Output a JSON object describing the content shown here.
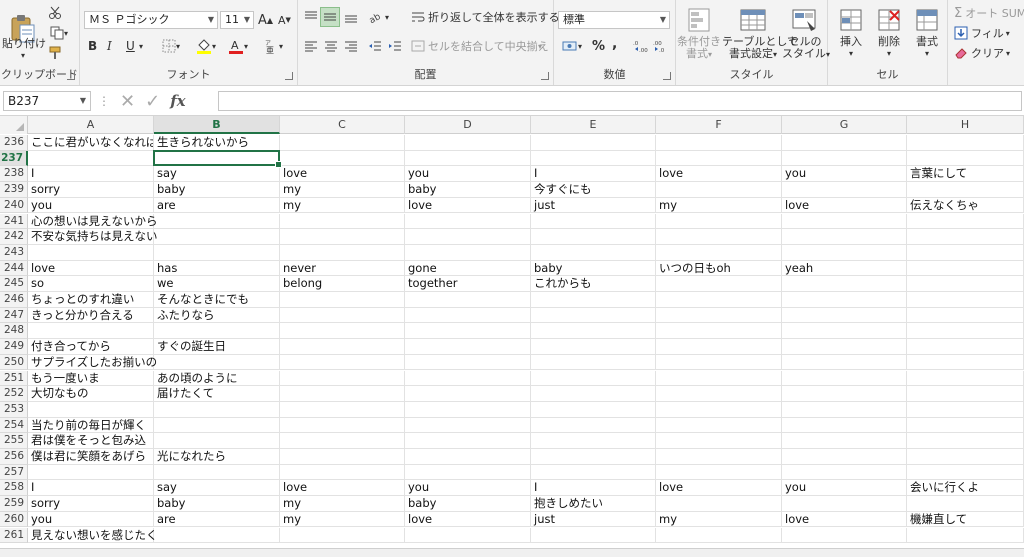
{
  "ribbon": {
    "clipboard": {
      "label": "クリップボード",
      "paste_label": "貼り付け"
    },
    "font": {
      "label": "フォント",
      "font_name": "ＭＳ Ｐゴシック",
      "font_size": "11",
      "bold": "B",
      "italic": "I",
      "underline": "U"
    },
    "alignment": {
      "label": "配置",
      "wrap_text": "折り返して全体を表示する",
      "merge_center": "セルを結合して中央揃え"
    },
    "number": {
      "label": "数値",
      "format": "標準",
      "percent": "%",
      "comma": ","
    },
    "styles": {
      "label": "スタイル",
      "conditional_line1": "条件付き",
      "conditional_line2": "書式",
      "table_line1": "テーブルとして",
      "table_line2": "書式設定",
      "cell_line1": "セルの",
      "cell_line2": "スタイル"
    },
    "cells": {
      "label": "セル",
      "insert": "挿入",
      "delete": "削除",
      "format": "書式"
    },
    "editing": {
      "autosum": "オート SUM",
      "fill": "フィル",
      "clear": "クリア"
    }
  },
  "formula_bar": {
    "name_box": "B237",
    "formula": ""
  },
  "grid": {
    "columns": [
      "A",
      "B",
      "C",
      "D",
      "E",
      "F",
      "G",
      "H"
    ],
    "active_column": "B",
    "active_row": "237",
    "rows": [
      {
        "n": "236",
        "cells": [
          "ここに君がいなくなれば",
          "生きられないから",
          "",
          "",
          "",
          "",
          "",
          ""
        ]
      },
      {
        "n": "237",
        "cells": [
          "",
          "",
          "",
          "",
          "",
          "",
          "",
          ""
        ]
      },
      {
        "n": "238",
        "cells": [
          "I",
          "say",
          "love",
          "you",
          "I",
          "love",
          "you",
          "言葉にして"
        ]
      },
      {
        "n": "239",
        "cells": [
          "sorry",
          "baby",
          "my",
          "baby",
          "今すぐにも",
          "",
          "",
          ""
        ]
      },
      {
        "n": "240",
        "cells": [
          "you",
          "are",
          "my",
          "love",
          "just",
          "my",
          "love",
          "伝えなくちゃ"
        ]
      },
      {
        "n": "241",
        "cells": [
          "心の想いは見えないから",
          "",
          "",
          "",
          "",
          "",
          "",
          ""
        ]
      },
      {
        "n": "242",
        "cells": [
          "不安な気持ちは見えない",
          "",
          "",
          "",
          "",
          "",
          "",
          ""
        ]
      },
      {
        "n": "243",
        "cells": [
          "",
          "",
          "",
          "",
          "",
          "",
          "",
          ""
        ]
      },
      {
        "n": "244",
        "cells": [
          "love",
          "has",
          "never",
          "gone",
          "baby",
          "いつの日もoh",
          "yeah",
          ""
        ]
      },
      {
        "n": "245",
        "cells": [
          "so",
          "we",
          "belong",
          "together",
          "これからも",
          "",
          "",
          ""
        ]
      },
      {
        "n": "246",
        "cells": [
          "ちょっとのすれ違い",
          "そんなときにでも",
          "",
          "",
          "",
          "",
          "",
          ""
        ]
      },
      {
        "n": "247",
        "cells": [
          "きっと分かり合える",
          "ふたりなら",
          "",
          "",
          "",
          "",
          "",
          ""
        ]
      },
      {
        "n": "248",
        "cells": [
          "",
          "",
          "",
          "",
          "",
          "",
          "",
          ""
        ]
      },
      {
        "n": "249",
        "cells": [
          "付き合ってから",
          "すぐの誕生日",
          "",
          "",
          "",
          "",
          "",
          ""
        ]
      },
      {
        "n": "250",
        "cells": [
          "サプライズしたお揃いの",
          "",
          "",
          "",
          "",
          "",
          "",
          ""
        ]
      },
      {
        "n": "251",
        "cells": [
          "もう一度いま",
          "あの頃のように",
          "",
          "",
          "",
          "",
          "",
          ""
        ]
      },
      {
        "n": "252",
        "cells": [
          "大切なもの",
          "届けたくて",
          "",
          "",
          "",
          "",
          "",
          ""
        ]
      },
      {
        "n": "253",
        "cells": [
          "",
          "",
          "",
          "",
          "",
          "",
          "",
          ""
        ]
      },
      {
        "n": "254",
        "cells": [
          "当たり前の毎日が輝く",
          "",
          "",
          "",
          "",
          "",
          "",
          ""
        ]
      },
      {
        "n": "255",
        "cells": [
          "君は僕をそっと包み込",
          "",
          "",
          "",
          "",
          "",
          "",
          ""
        ]
      },
      {
        "n": "256",
        "cells": [
          "僕は君に笑顔をあげら",
          "光になれたら",
          "",
          "",
          "",
          "",
          "",
          ""
        ]
      },
      {
        "n": "257",
        "cells": [
          "",
          "",
          "",
          "",
          "",
          "",
          "",
          ""
        ]
      },
      {
        "n": "258",
        "cells": [
          "I",
          "say",
          "love",
          "you",
          "I",
          "love",
          "you",
          "会いに行くよ"
        ]
      },
      {
        "n": "259",
        "cells": [
          "sorry",
          "baby",
          "my",
          "baby",
          "抱きしめたい",
          "",
          "",
          ""
        ]
      },
      {
        "n": "260",
        "cells": [
          "you",
          "are",
          "my",
          "love",
          "just",
          "my",
          "love",
          "機嫌直して"
        ]
      },
      {
        "n": "261",
        "cells": [
          "見えない想いを感じたく",
          "",
          "",
          "",
          "",
          "",
          "",
          ""
        ]
      }
    ]
  }
}
